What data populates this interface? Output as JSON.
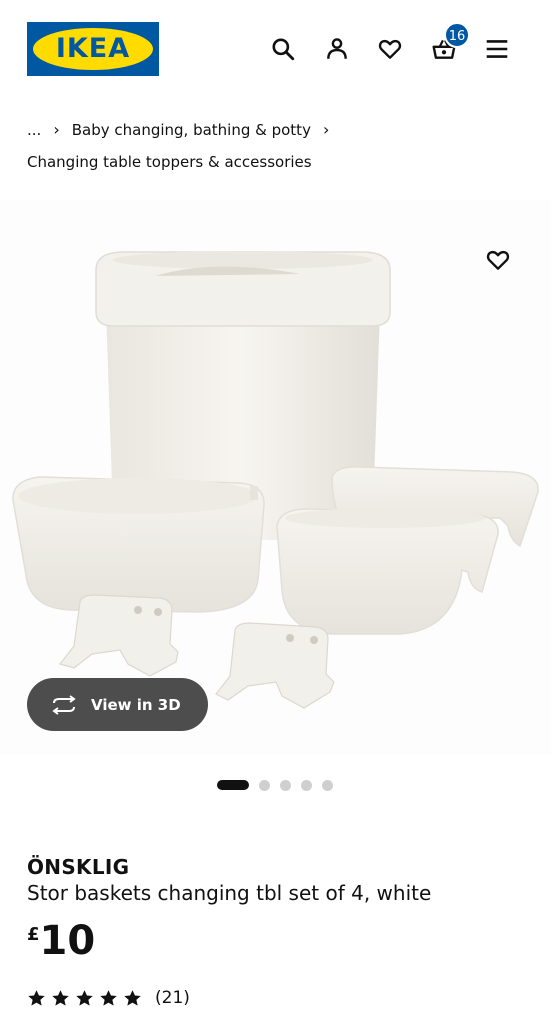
{
  "header": {
    "logo_text": "IKEA",
    "icons": [
      "search-icon",
      "account-icon",
      "heart-icon",
      "basket-icon",
      "menu-icon"
    ],
    "basket_count": "16"
  },
  "breadcrumb": {
    "ellipsis": "...",
    "sep": "›",
    "level1": "Baby changing, bathing & potty",
    "level2": "Changing table toppers & accessories"
  },
  "gallery": {
    "view3d_label": "View in 3D",
    "slide_count": 5,
    "active_slide": 1
  },
  "product": {
    "name": "ÖNSKLIG",
    "description": "Stor baskets changing tbl set of 4, white",
    "currency": "£",
    "price": "10",
    "rating_stars": 5,
    "review_count": "(21)"
  },
  "colors": {
    "brand_blue": "#0058a3",
    "brand_yellow": "#ffdb00",
    "text": "#111111"
  }
}
